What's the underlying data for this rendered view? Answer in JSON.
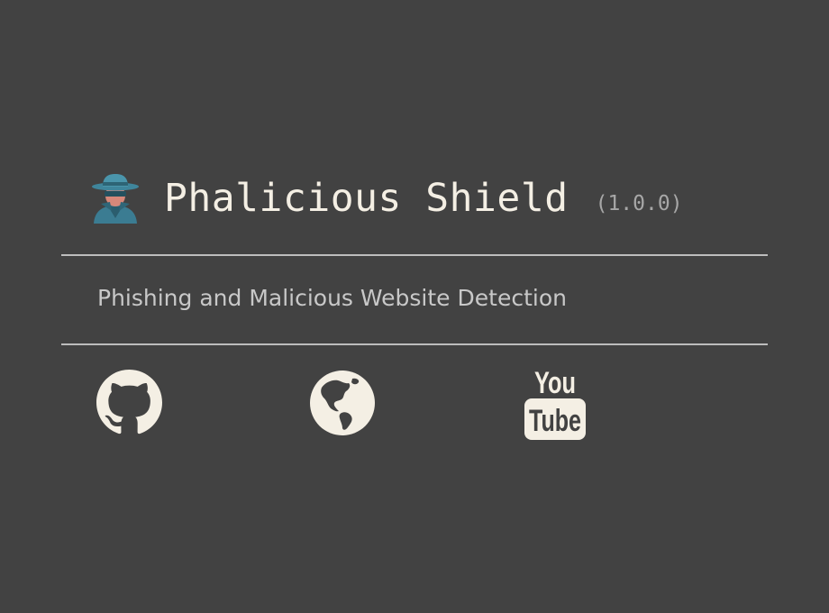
{
  "header": {
    "logo_icon": "spy-detective-icon",
    "app_name": "Phalicious Shield",
    "version": "(1.0.0)"
  },
  "subtitle": "Phishing and Malicious Website Detection",
  "links": [
    {
      "icon": "github-icon"
    },
    {
      "icon": "globe-icon"
    },
    {
      "icon": "youtube-icon",
      "glyph_text": [
        "You",
        "Tube"
      ]
    }
  ],
  "colors": {
    "background": "#424242",
    "title": "#f4efe4",
    "version": "#a7a7a7",
    "subtitle": "#c8c8c8",
    "divider": "#bdbdbd",
    "icon_fill": "#f4efe4"
  }
}
